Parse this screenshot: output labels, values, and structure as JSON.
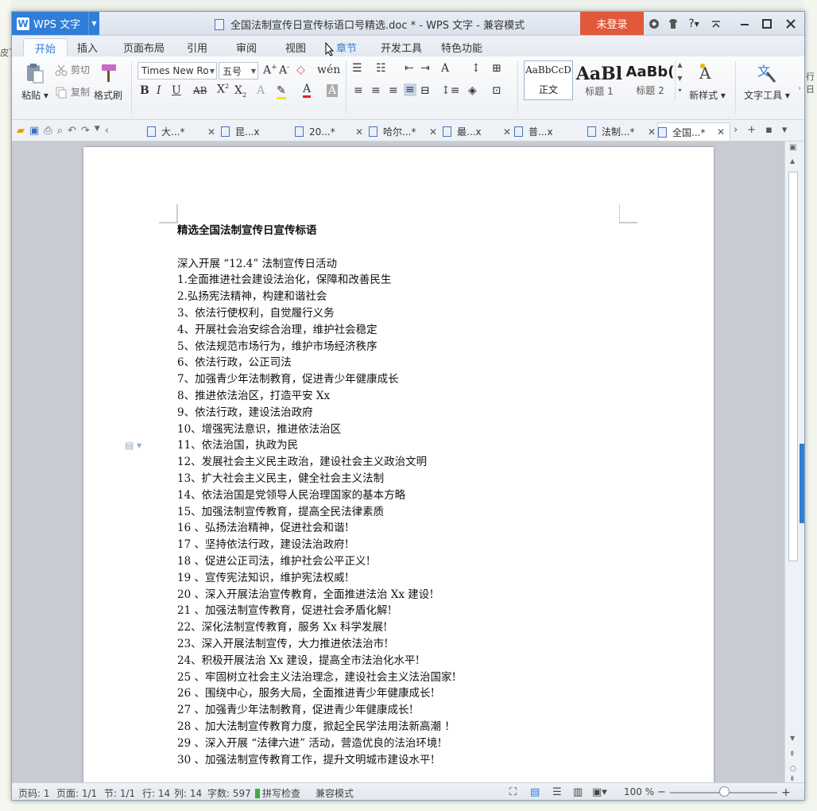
{
  "window": {
    "app_name": "WPS 文字",
    "title": "全国法制宣传日宣传标语口号精选.doc * - WPS 文字 - 兼容模式",
    "login_label": "未登录",
    "help_label": "?"
  },
  "ribbon_tabs": [
    "开始",
    "插入",
    "页面布局",
    "引用",
    "审阅",
    "视图",
    "章节",
    "开发工具",
    "特色功能"
  ],
  "clipboard": {
    "paste": "粘贴",
    "cut": "剪切",
    "copy": "复制",
    "format_painter": "格式刷"
  },
  "font": {
    "name": "Times New Ro",
    "size": "五号"
  },
  "styles": [
    {
      "preview": "AaBbCcD",
      "label": "正文"
    },
    {
      "preview": "AaBl",
      "label": "标题 1"
    },
    {
      "preview": "AaBb(",
      "label": "标题 2"
    }
  ],
  "new_style_label": "新样式",
  "text_tools_label": "文字工具",
  "doc_tabs": [
    {
      "label": "大...*"
    },
    {
      "label": "昆...x"
    },
    {
      "label": "20...*"
    },
    {
      "label": "哈尔...*"
    },
    {
      "label": "最...x"
    },
    {
      "label": "普...x"
    },
    {
      "label": "法制...*"
    },
    {
      "label": "全国...*"
    }
  ],
  "document": {
    "title": "精选全国法制宣传日宣传标语",
    "subtitle": "深入开展 “12.4” 法制宣传日活动",
    "lines": [
      "1.全面推进社会建设法治化，保障和改善民生",
      "2.弘扬宪法精神，构建和谐社会",
      "3、依法行使权利，自觉履行义务",
      "4、开展社会治安综合治理，维护社会稳定",
      "5、依法规范市场行为，维护市场经济秩序",
      "6、依法行政，公正司法",
      "7、加强青少年法制教育，促进青少年健康成长",
      "8、推进依法治区，打造平安 Xx",
      "9、依法行政，建设法治政府",
      "10、增强宪法意识，推进依法治区",
      "11、依法治国，执政为民",
      "12、发展社会主义民主政治，建设社会主义政治文明",
      "13、扩大社会主义民主，健全社会主义法制",
      "14、依法治国是党领导人民治理国家的基本方略",
      "15、加强法制宣传教育，提高全民法律素质",
      "16 、弘扬法治精神，促进社会和谐!",
      "17 、坚持依法行政，建设法治政府!",
      "18 、促进公正司法，维护社会公平正义!",
      "19 、宣传宪法知识，维护宪法权威!",
      "20 、深入开展法治宣传教育，全面推进法治 Xx 建设!",
      "21 、加强法制宣传教育，促进社会矛盾化解!",
      "22、深化法制宣传教育，服务 Xx 科学发展!",
      "23、深入开展法制宣传，大力推进依法治市!",
      "24、积极开展法治 Xx 建设，提高全市法治化水平!",
      "25 、牢固树立社会主义法治理念，建设社会主义法治国家!",
      "26 、围绕中心，服务大局，全面推进青少年健康成长!",
      "27 、加强青少年法制教育，促进青少年健康成长!",
      "28 、加大法制宣传教育力度，掀起全民学法用法新高潮 ！",
      "29 、深入开展 “法律六进” 活动，营造优良的法治环境!",
      "30 、加强法制宣传教育工作，提升文明城市建设水平!"
    ]
  },
  "status": {
    "page_no": "页码: 1",
    "pages": "页面: 1/1",
    "section": "节: 1/1",
    "row": "行: 14",
    "col": "列: 14",
    "words": "字数: 597",
    "spell": "拼写检查",
    "mode": "兼容模式",
    "zoom": "100 %"
  },
  "desktop": {
    "left_text": "皮下",
    "right_text": "行日"
  }
}
